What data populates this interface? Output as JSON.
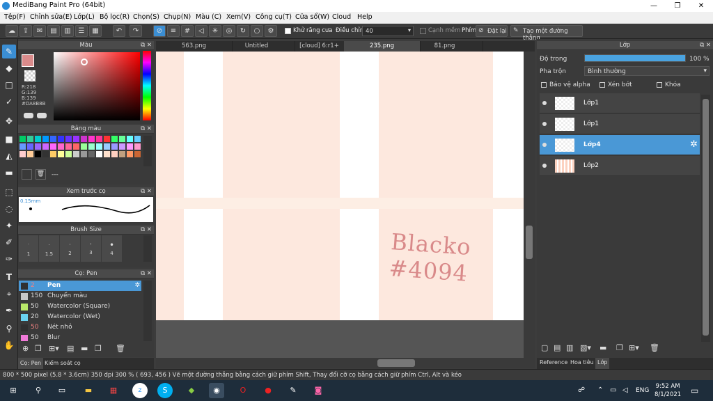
{
  "window": {
    "title": "MediBang Paint Pro (64bit)",
    "minimize": "—",
    "maximize": "❐",
    "close": "✕"
  },
  "menu": [
    "Tệp(F)",
    "Chỉnh sửa(E)",
    "Lớp(L)",
    "Bộ lọc(R)",
    "Chọn(S)",
    "Chụp(N)",
    "Màu (C)",
    "Xem(V)",
    "Công cụ(T)",
    "Cửa sổ(W)",
    "Cloud",
    "Help"
  ],
  "toolbar": {
    "antialias_label": "Khử răng cưa",
    "adjust_label": "Điều chỉnh",
    "adjust_value": "40",
    "edge_label": "Cạnh mềm",
    "key_label": "Phím",
    "reset_label": "Đặt lại",
    "line_label": "Tạo một đường thẳng"
  },
  "color_panel": {
    "title": "Màu",
    "r": "R:218",
    "g": "G:139",
    "b": "B:139",
    "hex": "#DA8B8B",
    "color_main": "#DA8B8B"
  },
  "palette_panel": {
    "title": "Bảng màu",
    "dash": "---"
  },
  "preview_panel": {
    "title": "Xem trước cọ",
    "size_text": "0.15mm"
  },
  "brush_size_panel": {
    "title": "Brush Size",
    "sizes": [
      "1",
      "1.5",
      "2",
      "3",
      "4"
    ]
  },
  "brush_panel": {
    "title": "Cọ: Pen",
    "items": [
      {
        "size": "2",
        "name": "Pen",
        "color": "#303030"
      },
      {
        "size": "150",
        "name": "Chuyển màu",
        "color": "#c8c8c8"
      },
      {
        "size": "50",
        "name": "Watercolor (Square)",
        "color": "#b9e86a"
      },
      {
        "size": "20",
        "name": "Watercolor (Wet)",
        "color": "#6ad3f0"
      },
      {
        "size": "50",
        "name": "Nét nhỏ",
        "color": "#303030"
      },
      {
        "size": "50",
        "name": "Blur",
        "color": "#f07ad8"
      }
    ]
  },
  "bottom_tabs": {
    "brush": "Cọ: Pen",
    "check": "Kiểm soát cọ"
  },
  "tabs": [
    "563.png",
    "Untitled",
    "[cloud] 6:r1+",
    "235.png",
    "81.png"
  ],
  "canvas_text": {
    "line1": "Blacko",
    "line2": "#4094"
  },
  "layer_panel": {
    "title": "Lớp",
    "opacity_label": "Độ trong",
    "opacity_value": "100 %",
    "opacity_level": 1.0,
    "blend_label": "Pha trộn",
    "blend_value": "Bình thường",
    "protect_alpha": "Bảo vệ alpha",
    "clip": "Xén bớt",
    "lock": "Khóa",
    "layers": [
      {
        "name": "Lớp1",
        "active": false
      },
      {
        "name": "Lớp1",
        "active": false
      },
      {
        "name": "Lớp4",
        "active": true
      },
      {
        "name": "Lớp2",
        "active": false
      }
    ],
    "tabs": [
      "Reference",
      "Hoa tiêu",
      "Lớp"
    ]
  },
  "status": "800 * 500 pixel   (5.8 * 3.6cm)   350 dpi   300 %   ( 693, 456 )   Vẽ một đường thẳng bằng cách giữ phím Shift, Thay đổi cỡ cọ bằng cách giữ phím Ctrl, Alt và kéo",
  "taskbar": {
    "lang": "ENG",
    "time": "9:52 AM",
    "date": "8/1/2021"
  }
}
